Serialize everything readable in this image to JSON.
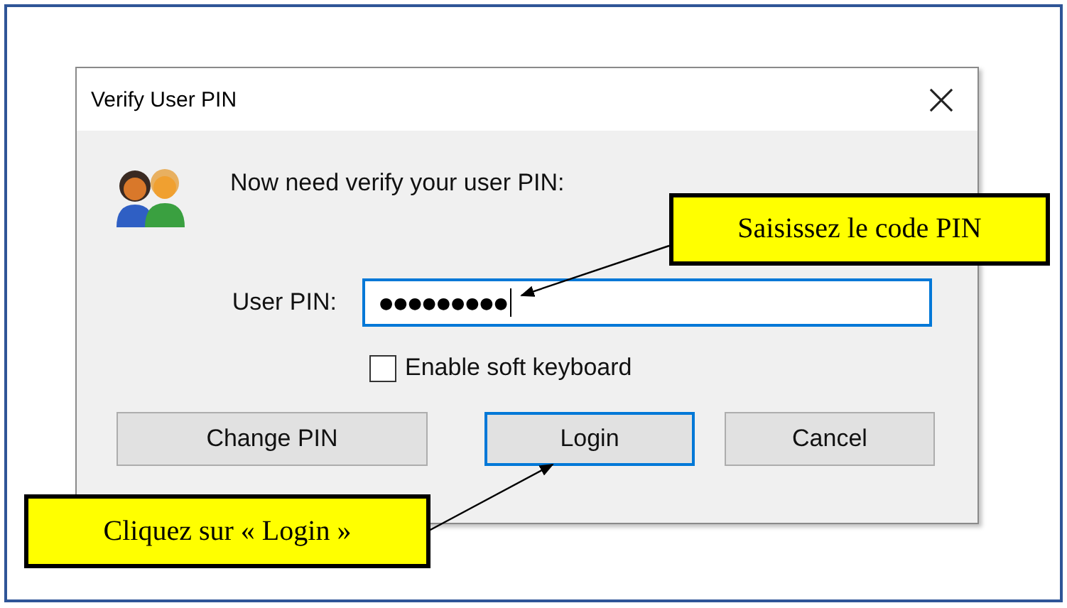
{
  "window": {
    "title": "Verify User PIN"
  },
  "message": "Now need verify your user PIN:",
  "pin_field": {
    "label": "User PIN:",
    "value": "●●●●●●●●●",
    "focused": true
  },
  "soft_keyboard": {
    "label": "Enable soft keyboard",
    "checked": false
  },
  "buttons": [
    {
      "label": "Change PIN",
      "focused": false
    },
    {
      "label": "Login",
      "focused": true
    },
    {
      "label": "Cancel",
      "focused": false
    }
  ],
  "callouts": [
    {
      "text": "Saisissez le code PIN"
    },
    {
      "text": "Cliquez sur « Login »"
    }
  ]
}
